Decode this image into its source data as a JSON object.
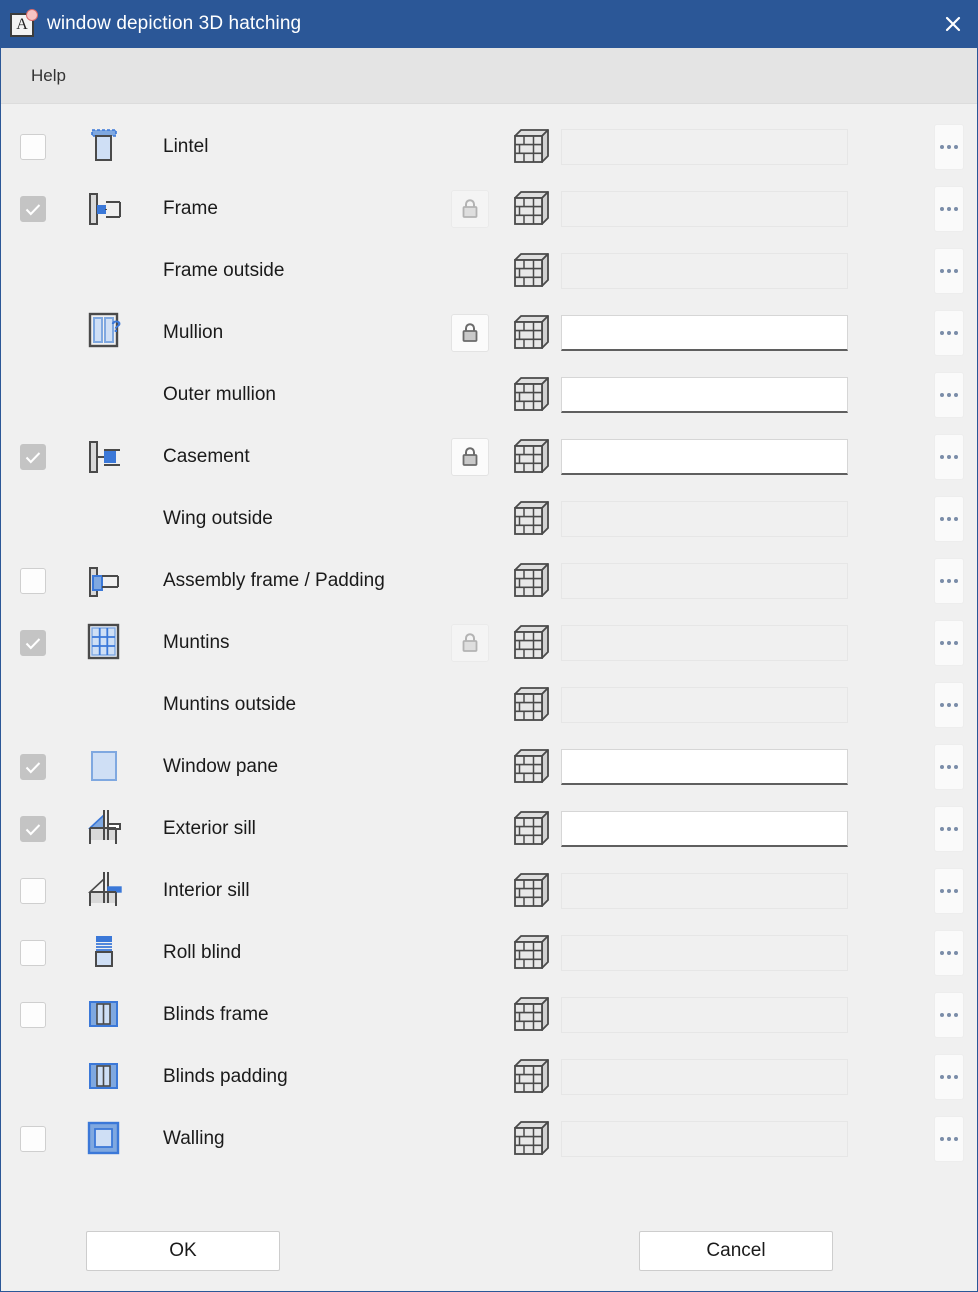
{
  "window": {
    "title": "window depiction 3D hatching",
    "app_icon": "letter-a-icon",
    "close_icon": "close-icon"
  },
  "menubar": {
    "items": [
      {
        "label": "Help",
        "name": "menu-item-help"
      }
    ]
  },
  "columns": {
    "checkbox": "enabled-checkbox",
    "preview": "component-preview-icon",
    "label": "component-name",
    "lock": "lock-toggle",
    "hatch": "hatching-pattern-icon",
    "value": "hatching-value",
    "browse": "browse-button"
  },
  "rows": [
    {
      "label": "Lintel",
      "checkbox": "unchecked",
      "preview": "lintel-icon",
      "lock": "none",
      "hatch_icon": "brick-wall-icon",
      "value": "",
      "field_enabled": false,
      "browse_label": "..."
    },
    {
      "label": "Frame",
      "checkbox": "checked",
      "preview": "frame-icon",
      "lock": "disabled",
      "hatch_icon": "brick-wall-icon",
      "value": "",
      "field_enabled": false,
      "browse_label": "..."
    },
    {
      "label": "Frame outside",
      "checkbox": "none",
      "preview": "none",
      "lock": "none",
      "hatch_icon": "brick-wall-icon",
      "value": "",
      "field_enabled": false,
      "browse_label": "..."
    },
    {
      "label": "Mullion",
      "checkbox": "none",
      "preview": "mullion-icon",
      "lock": "locked",
      "hatch_icon": "brick-wall-icon",
      "value": "",
      "field_enabled": true,
      "browse_label": "..."
    },
    {
      "label": "Outer mullion",
      "checkbox": "none",
      "preview": "none",
      "lock": "none",
      "hatch_icon": "brick-wall-icon",
      "value": "",
      "field_enabled": true,
      "browse_label": "..."
    },
    {
      "label": "Casement",
      "checkbox": "checked",
      "preview": "casement-icon",
      "lock": "locked",
      "hatch_icon": "brick-wall-icon",
      "value": "",
      "field_enabled": true,
      "browse_label": "..."
    },
    {
      "label": "Wing outside",
      "checkbox": "none",
      "preview": "none",
      "lock": "none",
      "hatch_icon": "brick-wall-icon",
      "value": "",
      "field_enabled": false,
      "browse_label": "..."
    },
    {
      "label": "Assembly frame / Padding",
      "checkbox": "unchecked",
      "preview": "assembly-frame-icon",
      "lock": "none",
      "hatch_icon": "brick-wall-icon",
      "value": "",
      "field_enabled": false,
      "browse_label": "..."
    },
    {
      "label": "Muntins",
      "checkbox": "checked",
      "preview": "muntins-icon",
      "lock": "disabled",
      "hatch_icon": "brick-wall-icon",
      "value": "",
      "field_enabled": false,
      "browse_label": "..."
    },
    {
      "label": "Muntins outside",
      "checkbox": "none",
      "preview": "none",
      "lock": "none",
      "hatch_icon": "brick-wall-icon",
      "value": "",
      "field_enabled": false,
      "browse_label": "..."
    },
    {
      "label": "Window pane",
      "checkbox": "checked",
      "preview": "window-pane-icon",
      "lock": "none",
      "hatch_icon": "brick-wall-icon",
      "value": "",
      "field_enabled": true,
      "browse_label": "..."
    },
    {
      "label": "Exterior sill",
      "checkbox": "checked",
      "preview": "exterior-sill-icon",
      "lock": "none",
      "hatch_icon": "brick-wall-icon",
      "value": "",
      "field_enabled": true,
      "browse_label": "..."
    },
    {
      "label": "Interior sill",
      "checkbox": "unchecked",
      "preview": "interior-sill-icon",
      "lock": "none",
      "hatch_icon": "brick-wall-icon",
      "value": "",
      "field_enabled": false,
      "browse_label": "..."
    },
    {
      "label": "Roll blind",
      "checkbox": "unchecked",
      "preview": "roll-blind-icon",
      "lock": "none",
      "hatch_icon": "brick-wall-icon",
      "value": "",
      "field_enabled": false,
      "browse_label": "..."
    },
    {
      "label": "Blinds frame",
      "checkbox": "unchecked",
      "preview": "blinds-frame-icon",
      "lock": "none",
      "hatch_icon": "brick-wall-icon",
      "value": "",
      "field_enabled": false,
      "browse_label": "..."
    },
    {
      "label": "Blinds padding",
      "checkbox": "none",
      "preview": "blinds-padding-icon",
      "lock": "none",
      "hatch_icon": "brick-wall-icon",
      "value": "",
      "field_enabled": false,
      "browse_label": "..."
    },
    {
      "label": "Walling",
      "checkbox": "unchecked",
      "preview": "walling-icon",
      "lock": "none",
      "hatch_icon": "brick-wall-icon",
      "value": "",
      "field_enabled": false,
      "browse_label": "..."
    }
  ],
  "footer": {
    "ok_label": "OK",
    "cancel_label": "Cancel"
  },
  "colors": {
    "titlebar": "#2b5797",
    "accent_blue": "#3b78d8",
    "body_bg": "#f0f0f0",
    "menubar_bg": "#e4e4e4",
    "checkbox_checked": "#c4c4c4"
  }
}
